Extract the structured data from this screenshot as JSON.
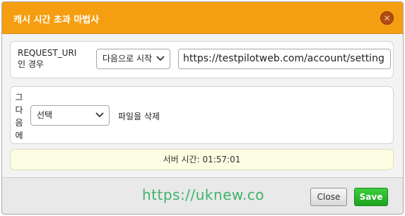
{
  "dialog": {
    "title": "캐시 시간 초과 마법사",
    "close_glyph": "✕"
  },
  "condition": {
    "label_line1": "REQUEST_URI",
    "label_line2": "인 경우",
    "operator_value": "다음으로 시작",
    "url_value": "https://testpilotweb.com/account/setting"
  },
  "action": {
    "label_chars": [
      "그",
      "다",
      "음",
      "에"
    ],
    "select_value": "선택",
    "description": "파일을 삭제"
  },
  "server_time": "서버 시간: 01:57:01",
  "watermark": "https://uknew.co",
  "buttons": {
    "close": "Close",
    "save": "Save"
  },
  "colors": {
    "titlebar": "#f59e11",
    "save": "#2dba2d",
    "server_bar": "#fdfde3",
    "watermark": "#3fb36a"
  }
}
